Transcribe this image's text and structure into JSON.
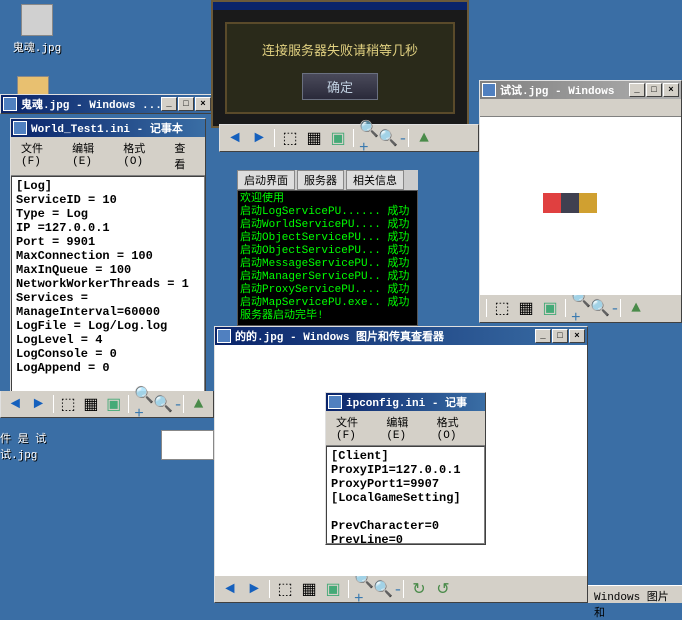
{
  "desktop": {
    "icon1": {
      "label": "鬼魂.jpg"
    },
    "icon2": {
      "label": "件 是 试\n试.jpg"
    }
  },
  "guihun_viewer": {
    "title": "鬼魂.jpg - Windows ..."
  },
  "world_test": {
    "title": "World_Test1.ini - 记事本",
    "menu": {
      "file": "文件(F)",
      "edit": "编辑(E)",
      "format": "格式(O)",
      "view": "查看"
    },
    "content": "[Log]\nServiceID = 10\nType = Log\nIP =127.0.0.1\nPort = 9901\nMaxConnection = 100\nMaxInQueue = 100\nNetworkWorkerThreads = 1\nServices =\nManageInterval=60000\nLogFile = Log/Log.log\nLogLevel = 4\nLogConsole = 0\nLogAppend = 0"
  },
  "game_dialog": {
    "message": "连接服务器失败请稍等几秒",
    "ok": "确定"
  },
  "console": {
    "tabs": {
      "t1": "启动界面",
      "t2": "服务器",
      "t3": "相关信息"
    },
    "line0": "欢迎使用",
    "line1": "启动LogServicePU...... 成功",
    "line2": "启动WorldServicePU.... 成功",
    "line3": "启动ObjectServicePU... 成功",
    "line4": "启动ObjectServicePU... 成功",
    "line5": "启动MessageServicePU.. 成功",
    "line6": "启动ManagerServicePU.. 成功",
    "line7": "启动ProxyServicePU.... 成功",
    "line8": "启动MapServicePU.exe.. 成功",
    "line9": "服务器启动完毕!"
  },
  "shishi_viewer": {
    "title_frag": "试试.jpg - Windows  "
  },
  "dede_viewer": {
    "title": "的的.jpg - Windows 图片和传真查看器"
  },
  "ipconfig": {
    "title": "ipconfig.ini - 记事",
    "menu": {
      "file": "文件(F)",
      "edit": "编辑(E)",
      "format": "格式(O)"
    },
    "content": "[Client]\nProxyIP1=127.0.0.1\nProxyPort1=9907\n[LocalGameSetting]\n\nPrevCharacter=0\nPrevLine=0"
  },
  "taskbar": {
    "label": "Windows 图片和"
  },
  "wincontrols": {
    "min": "_",
    "max": "□",
    "close": "×"
  }
}
